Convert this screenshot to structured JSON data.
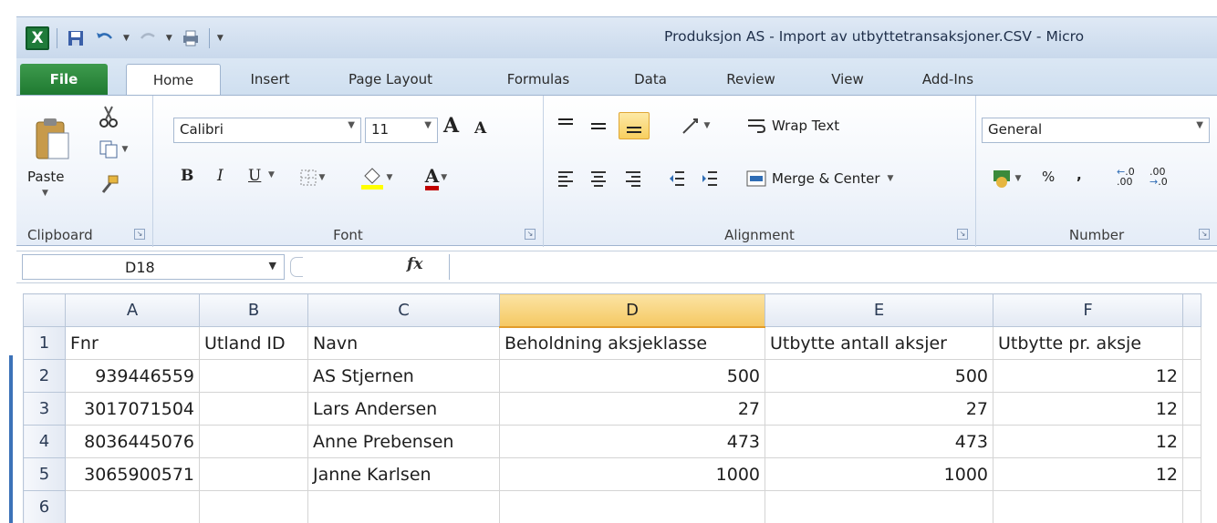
{
  "window": {
    "title": "Produksjon AS - Import av utbyttetransaksjoner.CSV  -  Micro"
  },
  "quick_access": {
    "app_icon": "excel-icon",
    "items": [
      "save-icon",
      "undo-icon",
      "redo-icon",
      "print-preview-icon",
      "customize-qat-icon"
    ]
  },
  "tabs": [
    "File",
    "Home",
    "Insert",
    "Page Layout",
    "Formulas",
    "Data",
    "Review",
    "View",
    "Add-Ins"
  ],
  "active_tab": "Home",
  "ribbon": {
    "clipboard": {
      "label": "Clipboard",
      "paste_label": "Paste"
    },
    "font": {
      "label": "Font",
      "font_name": "Calibri",
      "font_size": "11",
      "bold": "B",
      "italic": "I",
      "underline": "U",
      "grow": "A",
      "shrink": "A",
      "font_color": "A",
      "font_color_hex": "#c00000",
      "fill_color_hex": "#ffff00"
    },
    "alignment": {
      "label": "Alignment",
      "wrap_text": "Wrap Text",
      "merge_center": "Merge & Center"
    },
    "number": {
      "label": "Number",
      "format": "General",
      "percent": "%",
      "comma": ",",
      "increase_decimal": ".00",
      "decrease_decimal": ".0"
    }
  },
  "formula_bar": {
    "name_box": "D18",
    "fx": "fx",
    "formula": ""
  },
  "sheet": {
    "columns": [
      "A",
      "B",
      "C",
      "D",
      "E",
      "F"
    ],
    "selected_column": "D",
    "rows": [
      {
        "n": "1",
        "cells": [
          "Fnr",
          "Utland ID",
          "Navn",
          "Beholdning aksjeklasse",
          "Utbytte antall aksjer",
          "Utbytte pr. aksje"
        ]
      },
      {
        "n": "2",
        "cells": [
          "939446559",
          "",
          "AS Stjernen",
          "500",
          "500",
          "12"
        ]
      },
      {
        "n": "3",
        "cells": [
          "3017071504",
          "",
          "Lars Andersen",
          "27",
          "27",
          "12"
        ]
      },
      {
        "n": "4",
        "cells": [
          "8036445076",
          "",
          "Anne Prebensen",
          "473",
          "473",
          "12"
        ]
      },
      {
        "n": "5",
        "cells": [
          "3065900571",
          "",
          "Janne Karlsen",
          "1000",
          "1000",
          "12"
        ]
      },
      {
        "n": "6",
        "cells": [
          "",
          "",
          "",
          "",
          "",
          ""
        ]
      }
    ]
  }
}
